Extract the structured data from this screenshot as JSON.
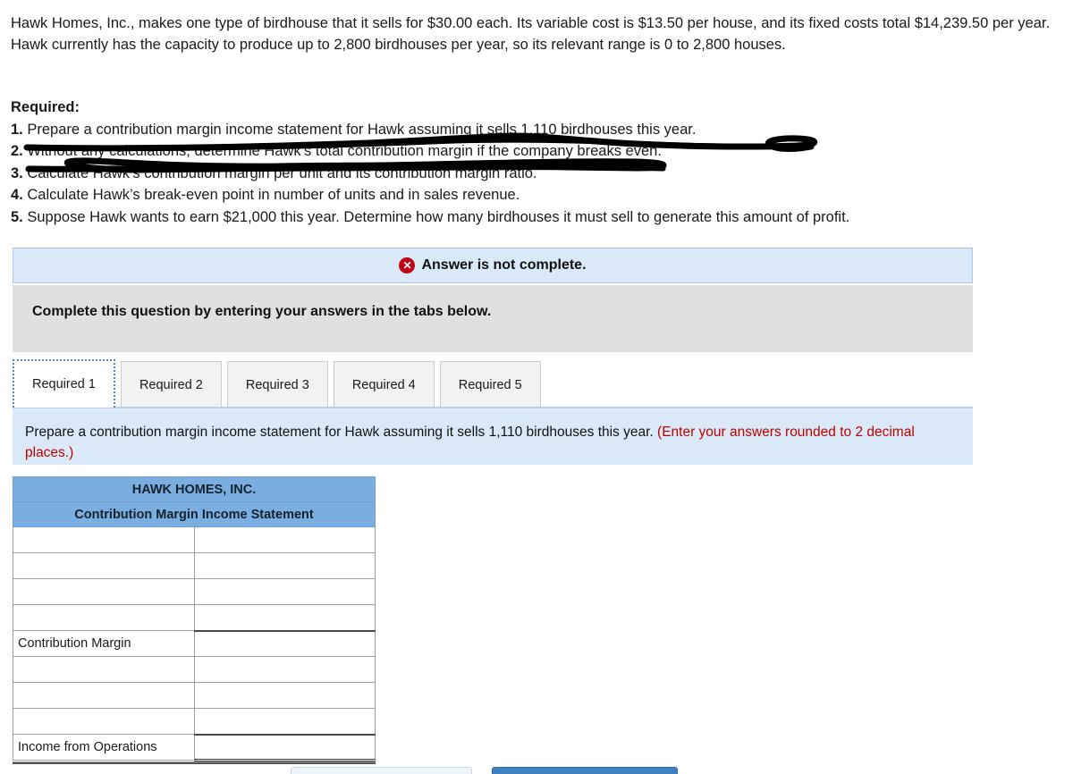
{
  "problem": {
    "text": "Hawk Homes, Inc., makes one type of birdhouse that it sells for $30.00 each. Its variable cost is $13.50 per house, and its fixed costs total $14,239.50 per year. Hawk currently has the capacity to produce up to 2,800 birdhouses per year, so its relevant range is 0 to 2,800 houses."
  },
  "required": {
    "heading": "Required:",
    "items": [
      {
        "num": "1.",
        "text": "Prepare a contribution margin income statement for Hawk assuming it sells 1,110 birdhouses this year.",
        "struck": false
      },
      {
        "num": "2.",
        "text": "Without any calculations, determine Hawk’s total contribution margin if the company breaks even.",
        "struck": true
      },
      {
        "num": "3.",
        "text": "Calculate Hawk’s contribution margin per unit and its contribution margin ratio.",
        "struck": true
      },
      {
        "num": "4.",
        "text": "Calculate Hawk’s break-even point in number of units and in sales revenue.",
        "struck": false
      },
      {
        "num": "5.",
        "text": "Suppose Hawk wants to earn $21,000 this year. Determine how many birdhouses it must sell to generate this amount of profit.",
        "struck": false
      }
    ]
  },
  "alert": {
    "icon": "error-x-icon",
    "text": "Answer is not complete.",
    "bg_color": "#d9e9f8",
    "icon_color": "#c00418"
  },
  "instruction_bar": {
    "text": "Complete this question by entering your answers in the tabs below.",
    "bg_color": "#e0e0e0"
  },
  "tabs": {
    "items": [
      {
        "label": "Required 1",
        "active": true
      },
      {
        "label": "Required 2",
        "active": false
      },
      {
        "label": "Required 3",
        "active": false
      },
      {
        "label": "Required 4",
        "active": false
      },
      {
        "label": "Required 5",
        "active": false
      }
    ]
  },
  "instruction_panel": {
    "main_text": "Prepare a contribution margin income statement for Hawk assuming it sells 1,110 birdhouses this year. ",
    "note_text": "(Enter your answers rounded to 2 decimal places.)",
    "note_color": "#c00000",
    "bg_color": "#d9e9f8"
  },
  "answer_table": {
    "header_color": "#7aaee0",
    "title_line_1": "HAWK HOMES, INC.",
    "title_line_2": "Contribution Margin Income Statement",
    "rows": [
      {
        "label": "",
        "value": "",
        "rule": "none"
      },
      {
        "label": "",
        "value": "",
        "rule": "none"
      },
      {
        "label": "",
        "value": "",
        "rule": "none"
      },
      {
        "label": "",
        "value": "",
        "rule": "subtotal"
      },
      {
        "label": "Contribution Margin",
        "value": "",
        "rule": "none"
      },
      {
        "label": "",
        "value": "",
        "rule": "none"
      },
      {
        "label": "",
        "value": "",
        "rule": "none"
      },
      {
        "label": "",
        "value": "",
        "rule": "subtotal"
      },
      {
        "label": "Income from Operations",
        "value": "",
        "rule": "total"
      }
    ]
  },
  "bottom_buttons": [
    {
      "name": "secondary-button",
      "style": "light"
    },
    {
      "name": "primary-button",
      "style": "primary"
    }
  ]
}
